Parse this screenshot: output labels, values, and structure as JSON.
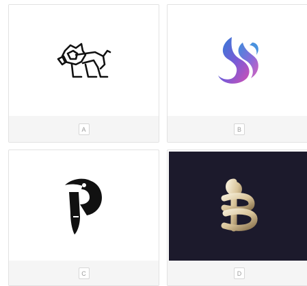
{
  "cards": [
    {
      "label": "A",
      "logo_icon": "lion-line-icon"
    },
    {
      "label": "B",
      "logo_icon": "swan-gradient-icon"
    },
    {
      "label": "C",
      "logo_icon": "toucan-p-icon"
    },
    {
      "label": "D",
      "logo_icon": "ribbon-b-icon"
    }
  ],
  "colors": {
    "card_border": "#e2e2e2",
    "footer_bg": "#f5f5f5",
    "dark_tile_bg": "#1c1a2c",
    "swan_gradient": [
      "#2a7fd8",
      "#d24fb4"
    ],
    "ribbon_gold": "#d9c49a"
  }
}
